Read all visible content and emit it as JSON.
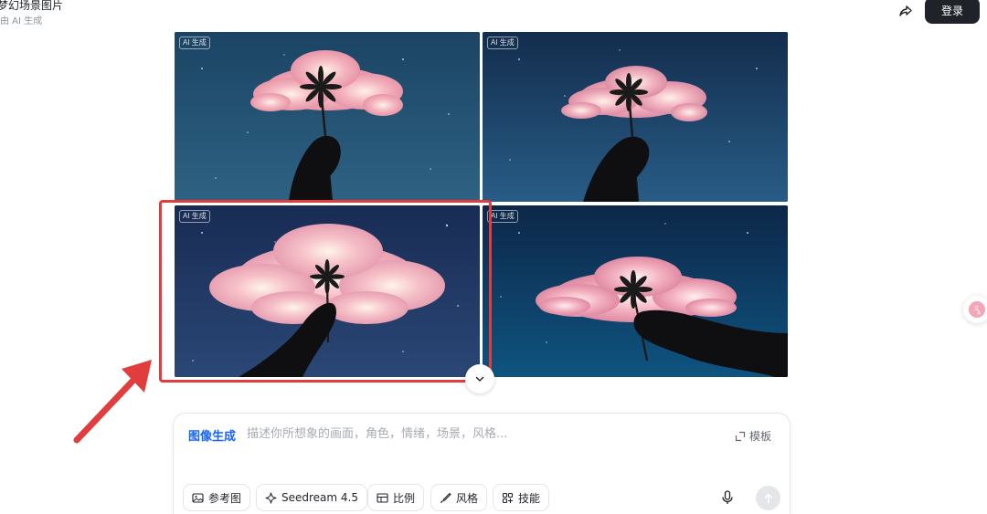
{
  "header": {
    "title": "梦幻场景图片",
    "subtitle": "由 AI 生成",
    "share_icon": "share-icon",
    "login_label": "登录"
  },
  "gallery": {
    "badge_label": "AI 生成",
    "selected_index": 2,
    "images": [
      {
        "description": "flower-cloud-night-sky",
        "badge": "AI 生成"
      },
      {
        "description": "flower-cloud-night-sky",
        "badge": "AI 生成"
      },
      {
        "description": "flower-cloud-night-sky",
        "badge": "AI 生成"
      },
      {
        "description": "flower-cloud-night-sky",
        "badge": "AI 生成"
      }
    ],
    "highlight_color": "#e23d3d",
    "collapse_icon": "chevron-down-icon"
  },
  "composer": {
    "mode_label": "图像生成",
    "placeholder": "描述你所想象的画面，角色，情绪，场景，风格...",
    "value": "",
    "template_label": "模板",
    "chips": {
      "reference_label": "参考图",
      "model_label": "Seedream 4.5",
      "ratio_label": "比例",
      "style_label": "风格",
      "skills_label": "技能"
    },
    "accent_color": "#1664ff"
  },
  "colors": {
    "login_bg": "#1f2329",
    "sky_top": "#16324f",
    "sky_bottom": "#0d2a47",
    "cloud": "#f2b3bd",
    "annotation": "#e23d3d"
  }
}
